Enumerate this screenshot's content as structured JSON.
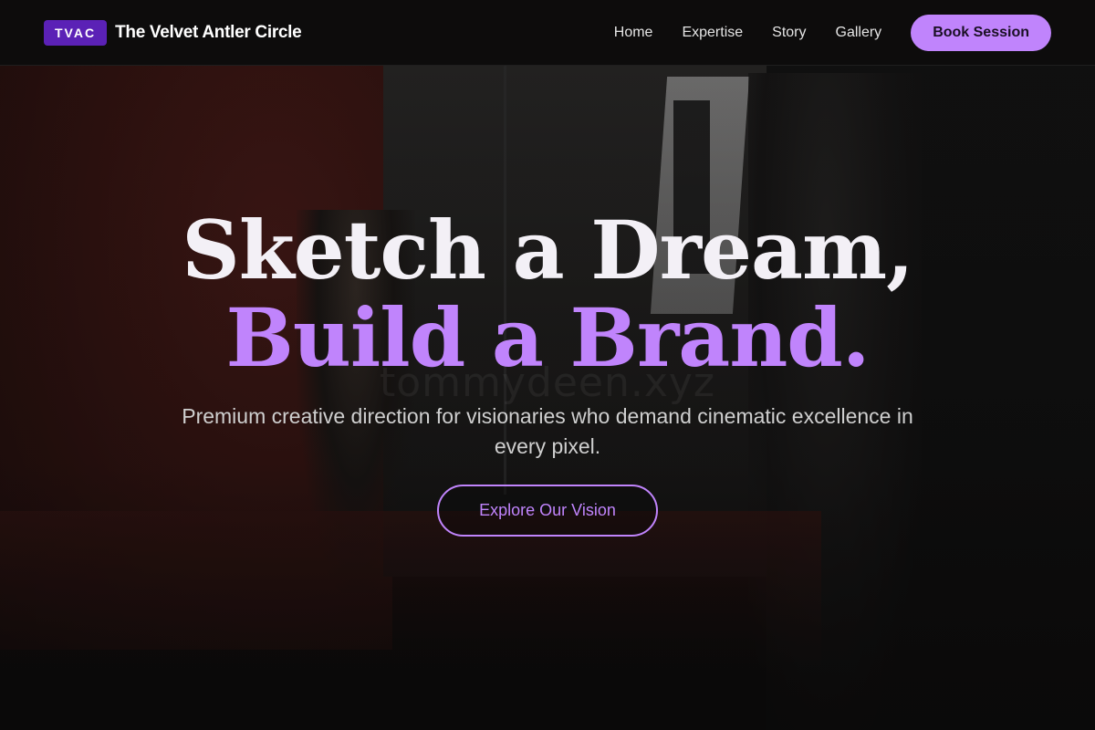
{
  "header": {
    "logo_text": "TVAC",
    "brand_name": "The Velvet Antler Circle",
    "nav": [
      {
        "label": "Home"
      },
      {
        "label": "Expertise"
      },
      {
        "label": "Story"
      },
      {
        "label": "Gallery"
      }
    ],
    "cta_label": "Book Session"
  },
  "hero": {
    "headline_line1": "Sketch a Dream,",
    "headline_line2": "Build a Brand.",
    "subtitle": "Premium creative direction for visionaries who demand cinematic excellence in every pixel.",
    "cta_label": "Explore Our Vision",
    "watermark": "tommydeen.xyz",
    "background": "photo-studio-backdrop"
  },
  "colors": {
    "accent": "#c084fc",
    "logo_bg": "#5b21b6",
    "navbar_bg": "#0d0c0c",
    "headline_primary": "#f3f0f6"
  }
}
